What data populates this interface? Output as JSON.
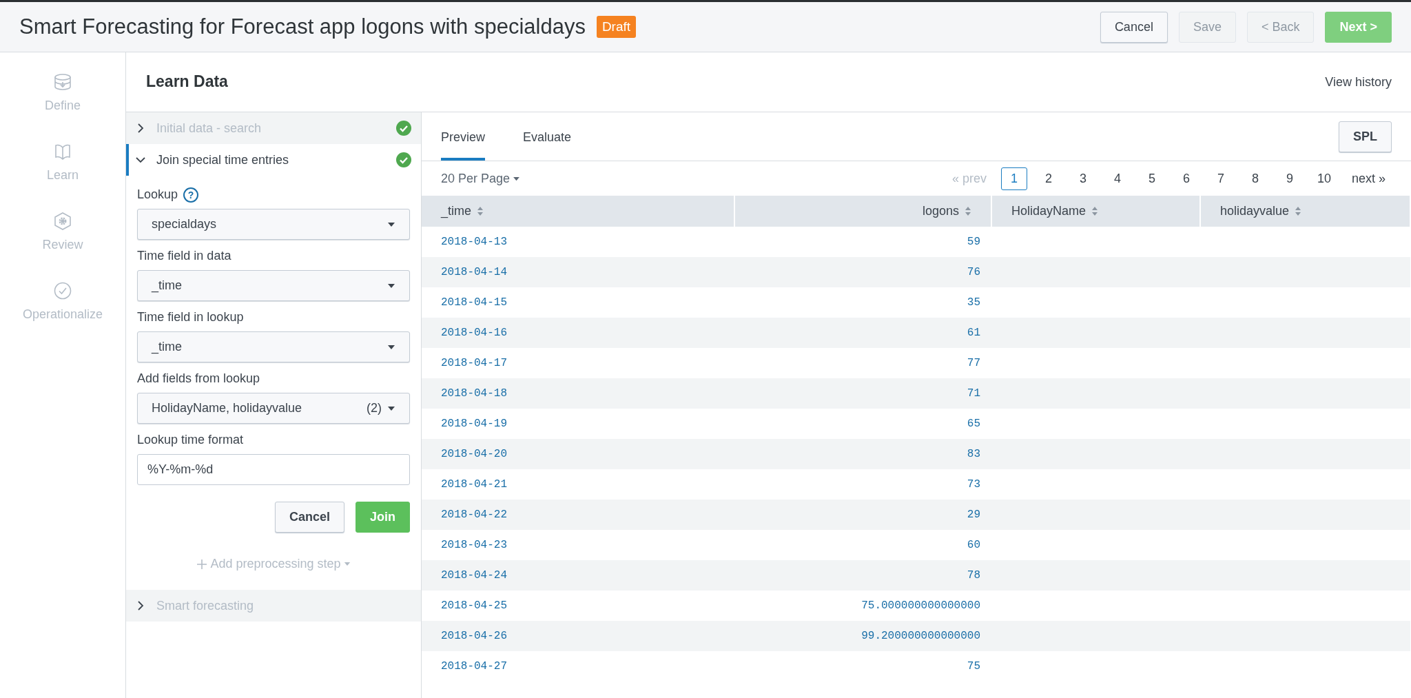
{
  "header": {
    "title": "Smart Forecasting for Forecast app logons with specialdays",
    "badge": "Draft",
    "buttons": [
      {
        "label": "Cancel",
        "kind": "default",
        "disabled": false
      },
      {
        "label": "Save",
        "kind": "default",
        "disabled": true
      },
      {
        "label": "< Back",
        "kind": "default",
        "disabled": true
      },
      {
        "label": "Next >",
        "kind": "primary",
        "disabled": true
      }
    ]
  },
  "nav": [
    {
      "label": "Define"
    },
    {
      "label": "Learn"
    },
    {
      "label": "Review"
    },
    {
      "label": "Operationalize"
    }
  ],
  "section": {
    "title": "Learn Data",
    "link": "View history"
  },
  "steps": [
    {
      "title": "Initial data - search",
      "expanded": false,
      "disabled": true,
      "complete": true
    },
    {
      "title": "Join special time entries",
      "expanded": true,
      "disabled": false,
      "complete": true,
      "form": {
        "fields": [
          {
            "kind": "select",
            "label": "Lookup",
            "help": "?",
            "value": "specialdays"
          },
          {
            "kind": "select",
            "label": "Time field in data",
            "value": "_time"
          },
          {
            "kind": "select",
            "label": "Time field in lookup",
            "value": "_time"
          },
          {
            "kind": "multiselect",
            "label": "Add fields from lookup",
            "value": "HolidayName, holidayvalue",
            "count": "(2)"
          },
          {
            "kind": "text",
            "label": "Lookup time format",
            "value": "%Y-%m-%d"
          }
        ],
        "buttons": [
          {
            "label": "Cancel",
            "kind": "default"
          },
          {
            "label": "Join",
            "kind": "primary"
          }
        ]
      }
    },
    {
      "title": "Smart forecasting",
      "expanded": false,
      "disabled": true,
      "complete": false
    }
  ],
  "add_step": "Add preprocessing step",
  "tabs": [
    {
      "label": "Preview",
      "selected": true
    },
    {
      "label": "Evaluate",
      "selected": false
    }
  ],
  "spl_button": "SPL",
  "per_page": "20 Per Page",
  "pagination": {
    "prev": "« prev",
    "prev_disabled": true,
    "pages": [
      {
        "label": "1",
        "selected": true
      },
      {
        "label": "2",
        "selected": false
      },
      {
        "label": "3",
        "selected": false
      },
      {
        "label": "4",
        "selected": false
      },
      {
        "label": "5",
        "selected": false
      },
      {
        "label": "6",
        "selected": false
      },
      {
        "label": "7",
        "selected": false
      },
      {
        "label": "8",
        "selected": false
      },
      {
        "label": "9",
        "selected": false
      },
      {
        "label": "10",
        "selected": false
      }
    ],
    "next": "next »"
  },
  "table": {
    "columns": [
      {
        "label": "_time"
      },
      {
        "label": "logons"
      },
      {
        "label": "HolidayName"
      },
      {
        "label": "holidayvalue"
      }
    ],
    "rows": [
      [
        "2018-04-13",
        "59"
      ],
      [
        "2018-04-14",
        "76"
      ],
      [
        "2018-04-15",
        "35"
      ],
      [
        "2018-04-16",
        "61"
      ],
      [
        "2018-04-17",
        "77"
      ],
      [
        "2018-04-18",
        "71"
      ],
      [
        "2018-04-19",
        "65"
      ],
      [
        "2018-04-20",
        "83"
      ],
      [
        "2018-04-21",
        "73"
      ],
      [
        "2018-04-22",
        "29"
      ],
      [
        "2018-04-23",
        "60"
      ],
      [
        "2018-04-24",
        "78"
      ],
      [
        "2018-04-25",
        "75.000000000000000"
      ],
      [
        "2018-04-26",
        "99.200000000000000"
      ],
      [
        "2018-04-27",
        "75"
      ]
    ]
  }
}
